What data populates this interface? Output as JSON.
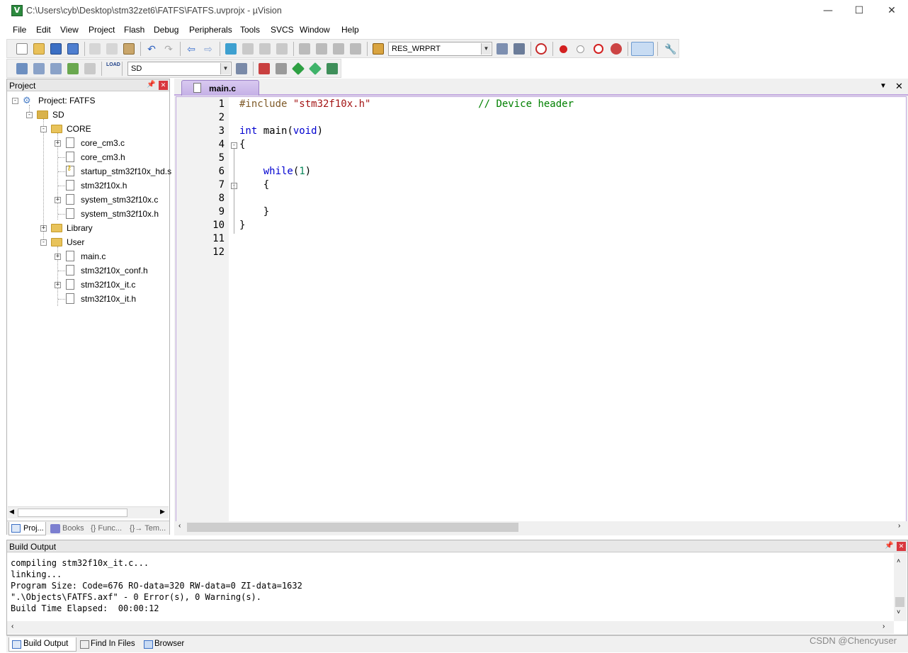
{
  "window": {
    "title": "C:\\Users\\cyb\\Desktop\\stm32zet6\\FATFS\\FATFS.uvprojx - µVision",
    "icon_letter": "V",
    "controls": {
      "minimize": "—",
      "maximize": "☐",
      "close": "✕"
    }
  },
  "menu": [
    "File",
    "Edit",
    "View",
    "Project",
    "Flash",
    "Debug",
    "Peripherals",
    "Tools",
    "SVCS",
    "Window",
    "Help"
  ],
  "toolbar": {
    "find_combo_value": "RES_WRPRT",
    "target_combo_value": "SD",
    "load_label": "LOAD"
  },
  "project_pane": {
    "title": "Project",
    "tree": [
      {
        "label": "Project: FATFS",
        "level": 0,
        "type": "project",
        "expander": "-"
      },
      {
        "label": "SD",
        "level": 1,
        "type": "target",
        "expander": "-"
      },
      {
        "label": "CORE",
        "level": 2,
        "type": "folder-open",
        "expander": "-"
      },
      {
        "label": "core_cm3.c",
        "level": 3,
        "type": "file",
        "expander": "+"
      },
      {
        "label": "core_cm3.h",
        "level": 3,
        "type": "file",
        "expander": ""
      },
      {
        "label": "startup_stm32f10x_hd.s",
        "level": 3,
        "type": "file-key",
        "expander": ""
      },
      {
        "label": "stm32f10x.h",
        "level": 3,
        "type": "file",
        "expander": ""
      },
      {
        "label": "system_stm32f10x.c",
        "level": 3,
        "type": "file",
        "expander": "+"
      },
      {
        "label": "system_stm32f10x.h",
        "level": 3,
        "type": "file",
        "expander": ""
      },
      {
        "label": "Library",
        "level": 2,
        "type": "folder",
        "expander": "+"
      },
      {
        "label": "User",
        "level": 2,
        "type": "folder-open",
        "expander": "-"
      },
      {
        "label": "main.c",
        "level": 3,
        "type": "file",
        "expander": "+"
      },
      {
        "label": "stm32f10x_conf.h",
        "level": 3,
        "type": "file",
        "expander": ""
      },
      {
        "label": "stm32f10x_it.c",
        "level": 3,
        "type": "file",
        "expander": "+"
      },
      {
        "label": "stm32f10x_it.h",
        "level": 3,
        "type": "file",
        "expander": ""
      }
    ],
    "tabs": [
      "Proj...",
      "Books",
      "{} Func...",
      "{}→ Tem..."
    ]
  },
  "editor": {
    "tab_label": "main.c",
    "lines": [
      {
        "n": "1",
        "text": "#include \"stm32f10x.h\"                  // Device header"
      },
      {
        "n": "2",
        "text": ""
      },
      {
        "n": "3",
        "text": "int main(void)"
      },
      {
        "n": "4",
        "text": "{"
      },
      {
        "n": "5",
        "text": ""
      },
      {
        "n": "6",
        "text": "    while(1)"
      },
      {
        "n": "7",
        "text": "    {"
      },
      {
        "n": "8",
        "text": ""
      },
      {
        "n": "9",
        "text": "    }"
      },
      {
        "n": "10",
        "text": "}"
      },
      {
        "n": "11",
        "text": ""
      },
      {
        "n": "12",
        "text": ""
      }
    ]
  },
  "build_output": {
    "title": "Build Output",
    "lines": [
      "compiling stm32f10x_it.c...",
      "linking...",
      "Program Size: Code=676 RO-data=320 RW-data=0 ZI-data=1632",
      "\".\\Objects\\FATFS.axf\" - 0 Error(s), 0 Warning(s).",
      "Build Time Elapsed:  00:00:12"
    ],
    "tabs": [
      "Build Output",
      "Find In Files",
      "Browser"
    ]
  },
  "watermark": "CSDN @Chencyuser",
  "colors": {
    "keyword": "#0000d0",
    "preprocessor": "#7f5a28",
    "string": "#a31515",
    "comment": "#008000",
    "number": "#098658",
    "tab_accent": "#c2a8e0"
  }
}
